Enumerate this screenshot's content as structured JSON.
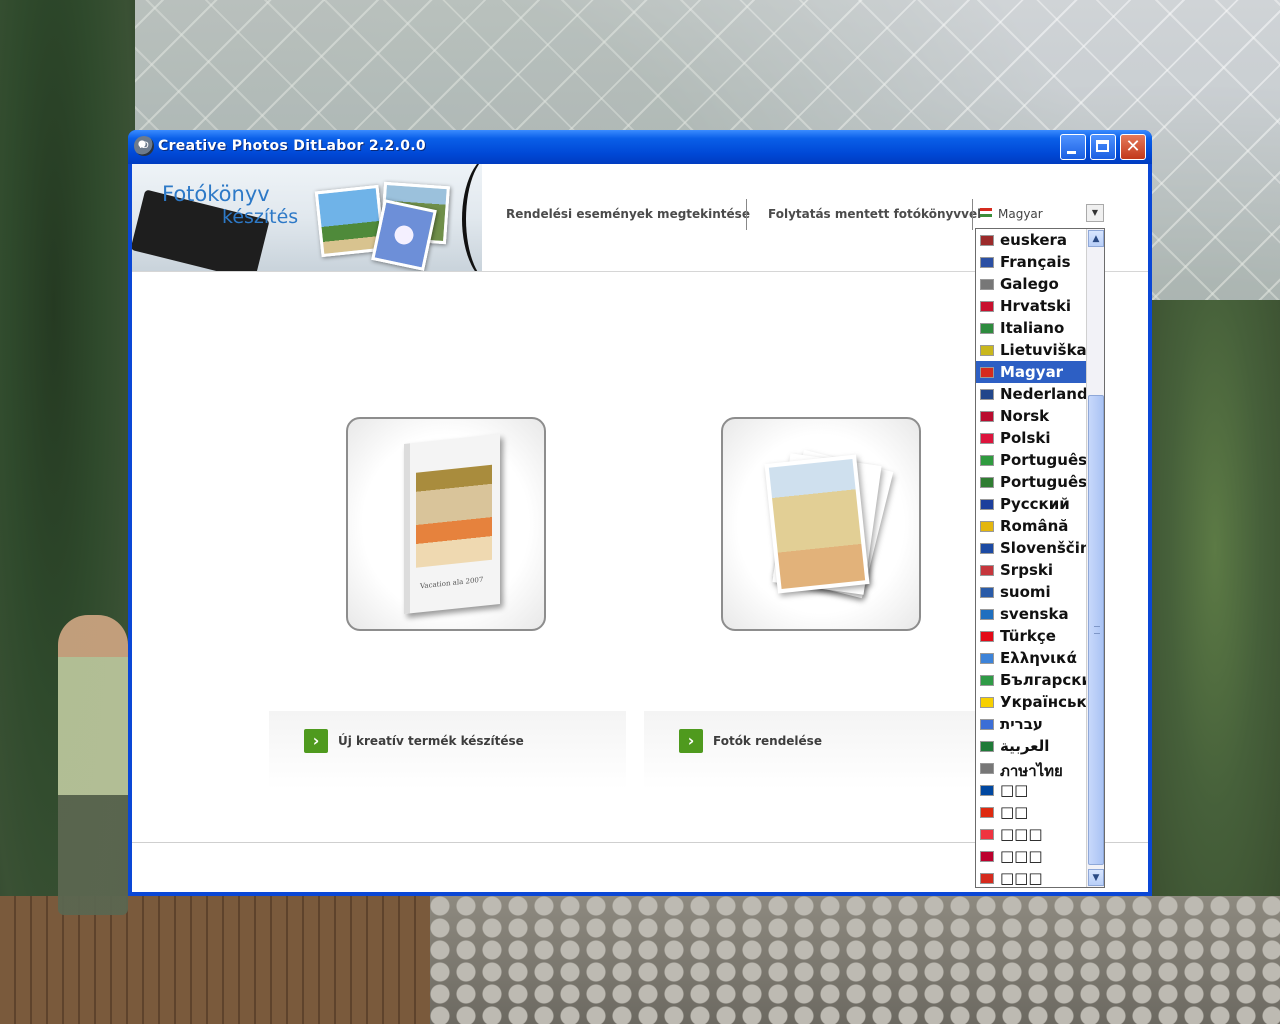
{
  "window": {
    "title": "Creative Photos DitLabor 2.2.0.0"
  },
  "banner": {
    "title": "Fotókönyv",
    "subtitle": "készítés"
  },
  "nav": {
    "view_orders": "Rendelési események megtekintése",
    "continue_saved": "Folytatás mentett fotókönyvvel"
  },
  "language_select": {
    "selected": "Magyar",
    "selected_flag_color": "#d52b1e"
  },
  "actions": {
    "new_product": "Új kreatív termék készítése",
    "order_photos": "Fotók rendelése"
  },
  "book_caption": "Vacation ala 2007",
  "language_options": [
    {
      "label": "euskera",
      "flag": "#9b2a2a"
    },
    {
      "label": "Français",
      "flag": "#2b4fa3"
    },
    {
      "label": "Galego",
      "flag": "#777777"
    },
    {
      "label": "Hrvatski",
      "flag": "#c8102e"
    },
    {
      "label": "Italiano",
      "flag": "#2e8b3e"
    },
    {
      "label": "Lietuviškai",
      "flag": "#c9b71d"
    },
    {
      "label": "Magyar",
      "flag": "#d52b1e"
    },
    {
      "label": "Nederlands",
      "flag": "#21468b"
    },
    {
      "label": "Norsk",
      "flag": "#ba0c2f"
    },
    {
      "label": "Polski",
      "flag": "#dc143c"
    },
    {
      "label": "Português",
      "flag": "#2f9a3f"
    },
    {
      "label": "Português",
      "flag": "#2f7d32"
    },
    {
      "label": "Русский",
      "flag": "#1c3f9c"
    },
    {
      "label": "Română",
      "flag": "#e3b60e"
    },
    {
      "label": "Slovenščina",
      "flag": "#1c4aa3"
    },
    {
      "label": "Srpski",
      "flag": "#c6363c"
    },
    {
      "label": "suomi",
      "flag": "#2a5ba8"
    },
    {
      "label": "svenska",
      "flag": "#1f6fbf"
    },
    {
      "label": "Türkçe",
      "flag": "#e30a17"
    },
    {
      "label": "Ελληνικά",
      "flag": "#3d83d8"
    },
    {
      "label": "Български",
      "flag": "#2f9a46"
    },
    {
      "label": "Українська",
      "flag": "#f7d000"
    },
    {
      "label": "עברית",
      "flag": "#3c6ed6"
    },
    {
      "label": "العربية",
      "flag": "#1f7a38"
    },
    {
      "label": "ภาษาไทย",
      "flag": "#777777"
    },
    {
      "label": "□□",
      "flag": "#0047a0"
    },
    {
      "label": "□□",
      "flag": "#de2910"
    },
    {
      "label": "□□□",
      "flag": "#ef3340"
    },
    {
      "label": "□□□",
      "flag": "#bc002d"
    },
    {
      "label": "□□□",
      "flag": "#d52b1e"
    }
  ],
  "selected_index": 6
}
